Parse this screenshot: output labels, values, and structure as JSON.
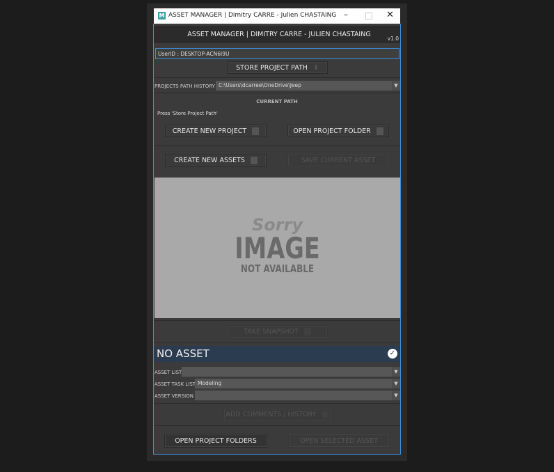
{
  "window": {
    "title": "ASSET MANAGER | Dimitry CARRE - Julien CHASTAING",
    "app_icon": "M"
  },
  "header": {
    "title": "ASSET MANAGER | DIMITRY CARRE - JULIEN CHASTAING",
    "version": "v1.0"
  },
  "user_id": "UserID : DESKTOP-ACN6I9U",
  "store_button": "STORE PROJECT PATH",
  "path_history": {
    "label": "PROJECTS PATH HISTORY",
    "value": "C:\\Users\\dcarree\\OneDrive\\Jeep"
  },
  "current_path": {
    "label": "CURRENT PATH",
    "value": "Press 'Store Project Path'"
  },
  "buttons": {
    "create_project": "CREATE NEW PROJECT",
    "open_project_folder": "OPEN PROJECT FOLDER",
    "create_assets": "CREATE NEW ASSETS",
    "save_asset": "SAVE CURRENT ASSET",
    "take_snapshot": "TAKE SNAPSHOT",
    "add_comments": "ADD COMMENTS / HISTORY",
    "open_project_folders": "OPEN PROJECT FOLDERS",
    "open_selected_asset": "OPEN SELECTED ASSET"
  },
  "preview": {
    "line1": "Sorry",
    "line2": "IMAGE",
    "line3": "NOT AVAILABLE"
  },
  "asset_banner": "NO ASSET",
  "fields": {
    "asset_list": {
      "label": "ASSET LIST",
      "value": ""
    },
    "asset_task_list": {
      "label": "ASSET TASK LIST",
      "value": "Modeling"
    },
    "asset_version": {
      "label": "ASSET VERSION",
      "value": ""
    }
  }
}
